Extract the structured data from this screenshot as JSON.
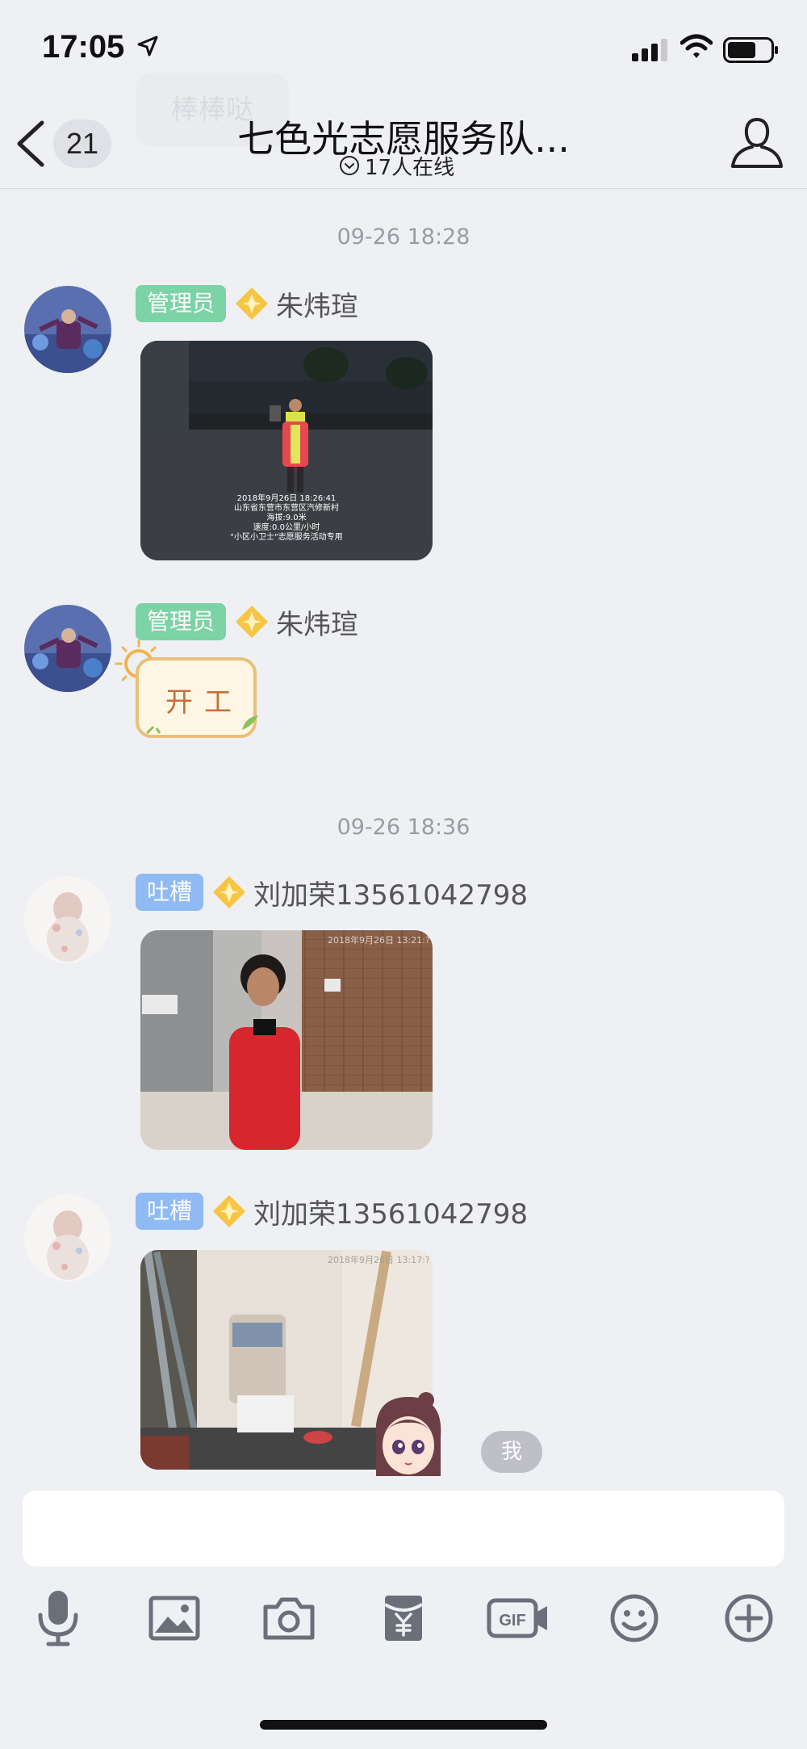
{
  "status_bar": {
    "time": "17:05"
  },
  "header": {
    "unread_count": "21",
    "pinned_ghost": "棒棒哒",
    "title": "七色光志愿服务队...",
    "online": "17人在线"
  },
  "messages": [
    {
      "type": "timestamp",
      "text": "09-26 18:28"
    },
    {
      "type": "photo",
      "role": "管理员",
      "sender": "朱炜瑄",
      "photo_caption": [
        "2018年9月26日 18:26:41",
        "山东省东营市东营区汽修新村",
        "海拔:9.0米",
        "速度:0.0公里/小时",
        "\"小区小卫士\"志愿服务活动专用"
      ]
    },
    {
      "type": "sticker",
      "role": "管理员",
      "sender": "朱炜瑄",
      "sticker_text": "开工"
    },
    {
      "type": "timestamp",
      "text": "09-26 18:36"
    },
    {
      "type": "photo",
      "role": "吐槽",
      "sender": "刘加荣13561042798",
      "photo_stamp": "2018年9月26日 13:21:?"
    },
    {
      "type": "photo",
      "role": "吐槽",
      "sender": "刘加荣13561042798",
      "photo_stamp": "2018年9月26日 13:17:?"
    }
  ],
  "me_bubble": "我",
  "toolbar": [
    "microphone-icon",
    "image-icon",
    "camera-icon",
    "red-packet-icon",
    "gif-icon",
    "emoji-icon",
    "plus-icon"
  ],
  "colors": {
    "admin_tag": "#7cd3a5",
    "tucao_tag": "#8fbaf4",
    "background": "#eef0f4",
    "icon": "#6b6f7a"
  }
}
